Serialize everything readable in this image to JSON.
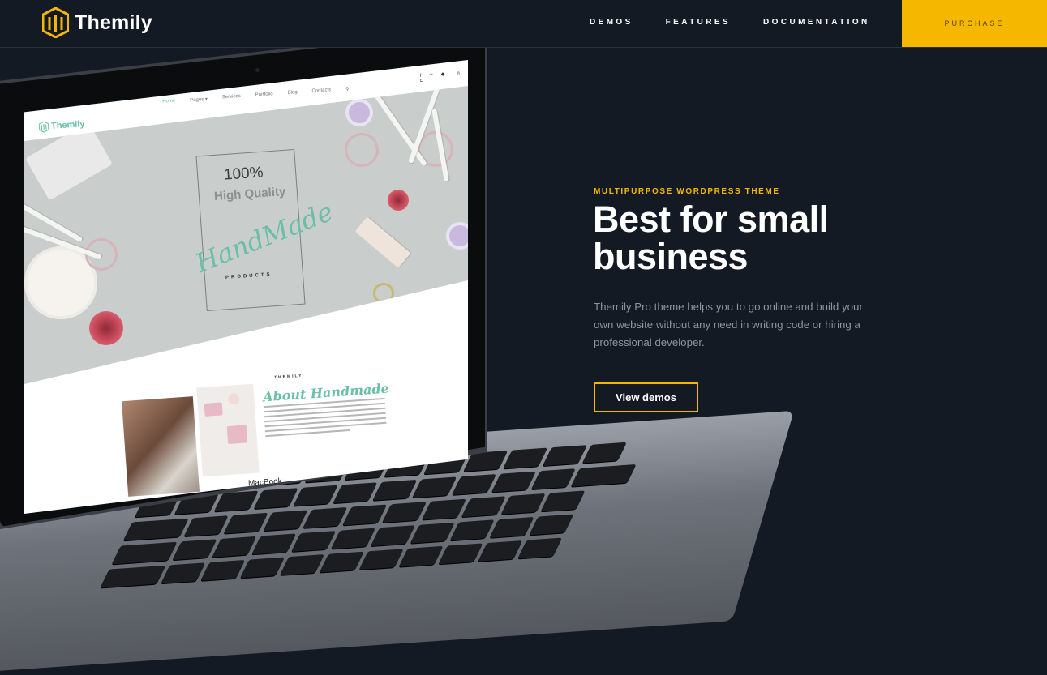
{
  "header": {
    "logo_text": "Themily",
    "nav": [
      "DEMOS",
      "FEATURES",
      "DOCUMENTATION"
    ],
    "purchase_label": "PURCHASE"
  },
  "hero": {
    "kicker": "MULTIPURPOSE WORDPRESS THEME",
    "title": "Best for small business",
    "description": "Themily Pro theme helps you to go online and build your own website without any need in writing code or hiring a professional developer.",
    "cta_label": "View demos"
  },
  "mockup": {
    "logo_text": "Themily",
    "nav": [
      "Home",
      "Pages ▾",
      "Services",
      "Portfolio",
      "Blog",
      "Contacts"
    ],
    "social": "f ✈ ◆ in ◘",
    "line1": "100%",
    "line2": "High Quality",
    "line3": "HandMade",
    "line4": "PRODUCTS",
    "about_kicker": "THEMILY",
    "about_title": "About Handmade",
    "device_label": "MacBook"
  },
  "colors": {
    "background": "#141a24",
    "accent": "#f5b700",
    "muted_text": "#8d93a0",
    "mint": "#6bbfa7"
  }
}
